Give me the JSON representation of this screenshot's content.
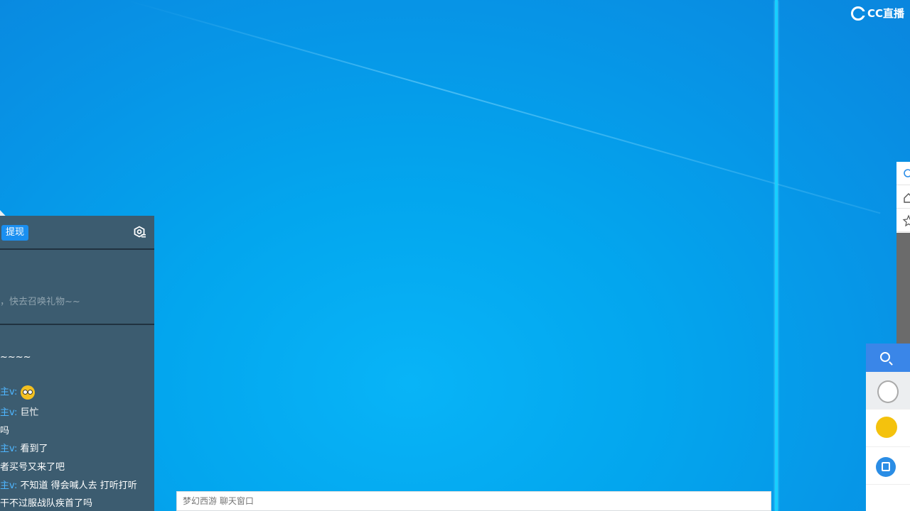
{
  "brand": {
    "logo_text": "CC直播"
  },
  "chat": {
    "withdraw_button": "提现",
    "notice": "，快去召唤礼物~~",
    "messages": [
      {
        "who": "",
        "text": "~~~~"
      },
      {
        "who": "主v:",
        "text": "",
        "emoji": "surprised-face-emoji"
      },
      {
        "who": "主v:",
        "text": "巨忙"
      },
      {
        "who": "",
        "text": "吗"
      },
      {
        "who": "主v:",
        "text": "看到了"
      },
      {
        "who": "",
        "text": "者买号又来了吧"
      },
      {
        "who": "主v:",
        "text": "不知道 得会喊人去 打听打听"
      },
      {
        "who": "",
        "text": "干不过服战队疾首了吗"
      }
    ]
  },
  "input": {
    "placeholder": "梦幻西游 聊天窗口"
  },
  "colors": {
    "accent": "#1a8ff0",
    "panel": "#3c5c70",
    "divider": "#16d0ff"
  }
}
